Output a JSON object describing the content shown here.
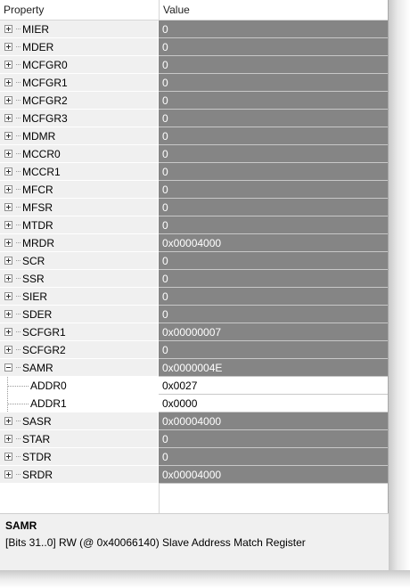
{
  "header": {
    "property": "Property",
    "value": "Value"
  },
  "rows": [
    {
      "name": "MIER",
      "value": "0",
      "expanded": false
    },
    {
      "name": "MDER",
      "value": "0",
      "expanded": false
    },
    {
      "name": "MCFGR0",
      "value": "0",
      "expanded": false
    },
    {
      "name": "MCFGR1",
      "value": "0",
      "expanded": false
    },
    {
      "name": "MCFGR2",
      "value": "0",
      "expanded": false
    },
    {
      "name": "MCFGR3",
      "value": "0",
      "expanded": false
    },
    {
      "name": "MDMR",
      "value": "0",
      "expanded": false
    },
    {
      "name": "MCCR0",
      "value": "0",
      "expanded": false
    },
    {
      "name": "MCCR1",
      "value": "0",
      "expanded": false
    },
    {
      "name": "MFCR",
      "value": "0",
      "expanded": false
    },
    {
      "name": "MFSR",
      "value": "0",
      "expanded": false
    },
    {
      "name": "MTDR",
      "value": "0",
      "expanded": false
    },
    {
      "name": "MRDR",
      "value": "0x00004000",
      "expanded": false
    },
    {
      "name": "SCR",
      "value": "0",
      "expanded": false
    },
    {
      "name": "SSR",
      "value": "0",
      "expanded": false
    },
    {
      "name": "SIER",
      "value": "0",
      "expanded": false
    },
    {
      "name": "SDER",
      "value": "0",
      "expanded": false
    },
    {
      "name": "SCFGR1",
      "value": "0x00000007",
      "expanded": false
    },
    {
      "name": "SCFGR2",
      "value": "0",
      "expanded": false
    },
    {
      "name": "SAMR",
      "value": "0x0000004E",
      "expanded": true,
      "children": [
        {
          "name": "ADDR0",
          "value": "0x0027"
        },
        {
          "name": "ADDR1",
          "value": "0x0000"
        }
      ]
    },
    {
      "name": "SASR",
      "value": "0x00004000",
      "expanded": false
    },
    {
      "name": "STAR",
      "value": "0",
      "expanded": false
    },
    {
      "name": "STDR",
      "value": "0",
      "expanded": false
    },
    {
      "name": "SRDR",
      "value": "0x00004000",
      "expanded": false
    }
  ],
  "description": {
    "title": "SAMR",
    "text": "[Bits 31..0] RW (@ 0x40066140) Slave Address Match Register"
  },
  "colors": {
    "value_bg": "#858585",
    "value_text": "#ffffff",
    "property_bg": "#f0f0f0"
  }
}
